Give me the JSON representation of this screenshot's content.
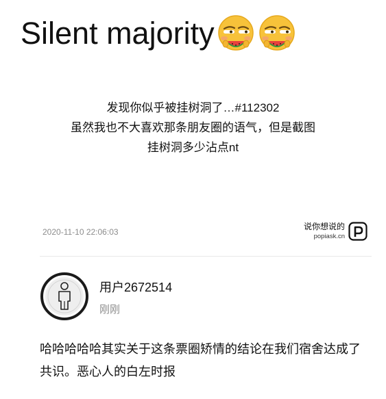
{
  "header": {
    "title": "Silent majority",
    "emojis": [
      "watermelon-face-emoji",
      "watermelon-face-emoji"
    ]
  },
  "post": {
    "lines": [
      "发现你似乎被挂树洞了…#112302",
      "虽然我也不大喜欢那条朋友圈的语气，但是截图",
      "挂树洞多少沾点nt"
    ],
    "timestamp": "2020-11-10 22:06:03"
  },
  "brand": {
    "name": "说你想说的",
    "url": "popiask.cn",
    "logo_letter": "p"
  },
  "comment": {
    "username": "用户2672514",
    "time_ago": "刚刚",
    "text": "哈哈哈哈哈其实关于这条票圈矫情的结论在我们宿舍达成了共识。恶心人的白左时报"
  },
  "colors": {
    "text": "#111111",
    "muted": "#8c8c8c",
    "divider": "#e8e8e8"
  }
}
